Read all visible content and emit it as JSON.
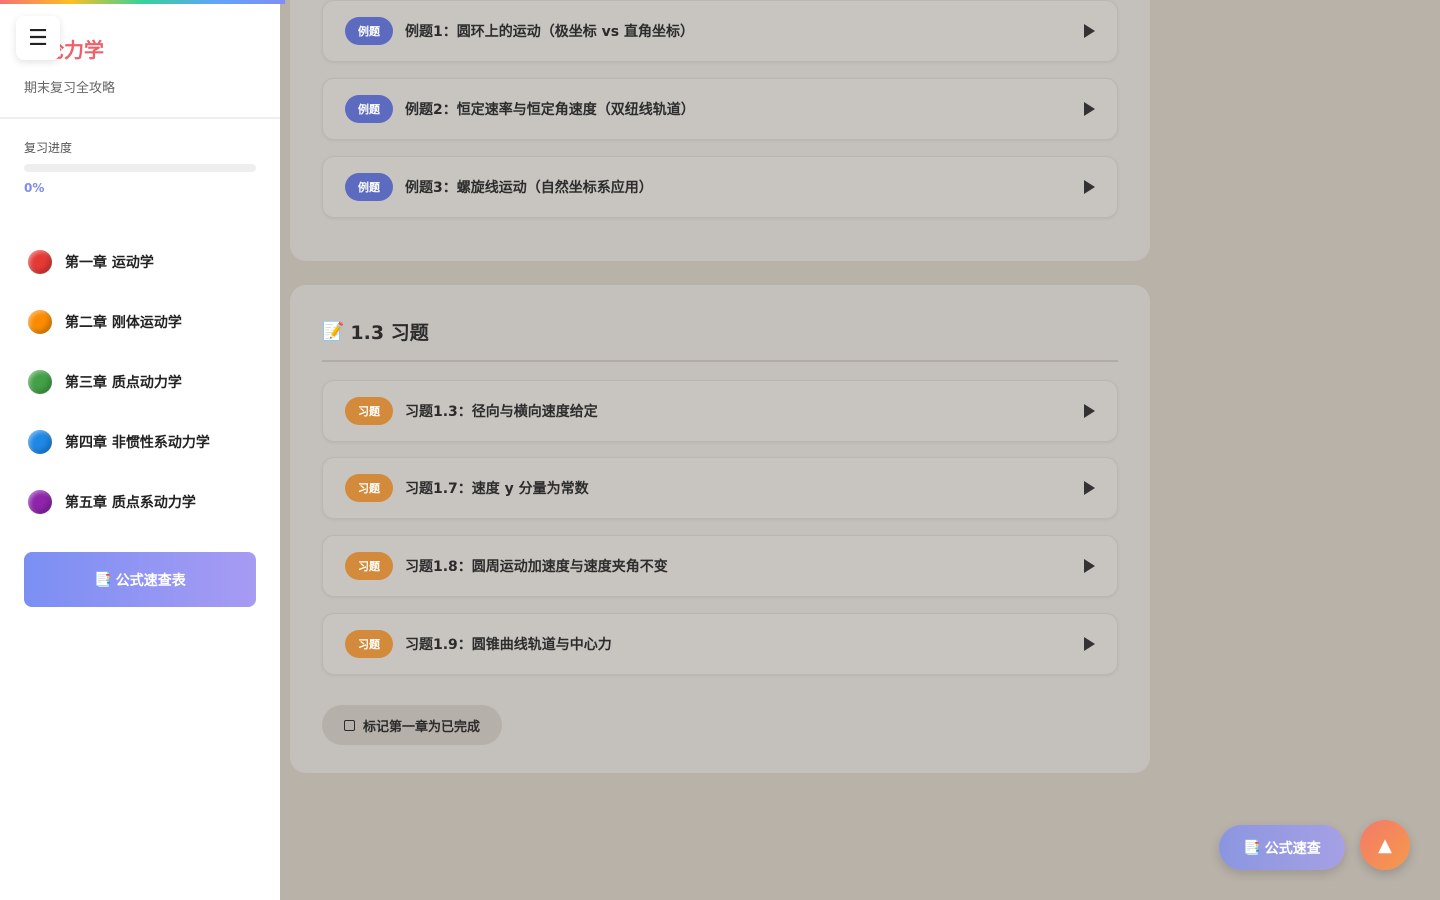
{
  "sidebar": {
    "menu_icon": "☰",
    "brand": "理论力学",
    "subtitle": "期末复习全攻略",
    "progress": {
      "label": "复习进度",
      "value_text": "0%",
      "fraction": 0
    },
    "chapters": [
      {
        "label": "第一章 运动学",
        "color": "#e53935"
      },
      {
        "label": "第二章 刚体运动学",
        "color": "#fb8c00"
      },
      {
        "label": "第三章 质点动力学",
        "color": "#43a047"
      },
      {
        "label": "第四章 非惯性系动力学",
        "color": "#1e88e5"
      },
      {
        "label": "第五章 质点系动力学",
        "color": "#8e24aa"
      }
    ],
    "formula_button": {
      "icon": "📑",
      "label": "公式速查表"
    }
  },
  "examples": {
    "tag": "例题",
    "tag_color": "#5c6bc0",
    "items": [
      "例题1：圆环上的运动（极坐标 vs 直角坐标）",
      "例题2：恒定速率与恒定角速度（双纽线轨道）",
      "例题3：螺旋线运动（自然坐标系应用）"
    ]
  },
  "exercises": {
    "section_icon": "📝",
    "section_title": "1.3 习题",
    "tag": "习题",
    "tag_color": "#d38a3a",
    "items": [
      "习题1.3：径向与横向速度给定",
      "习题1.7：速度 y 分量为常数",
      "习题1.8：圆周运动加速度与速度夹角不变",
      "习题1.9：圆锥曲线轨道与中心力"
    ],
    "mark_complete": "标记第一章为已完成"
  },
  "floating": {
    "formula": {
      "icon": "📑",
      "label": "公式速查"
    },
    "back_to_top": "▲"
  }
}
